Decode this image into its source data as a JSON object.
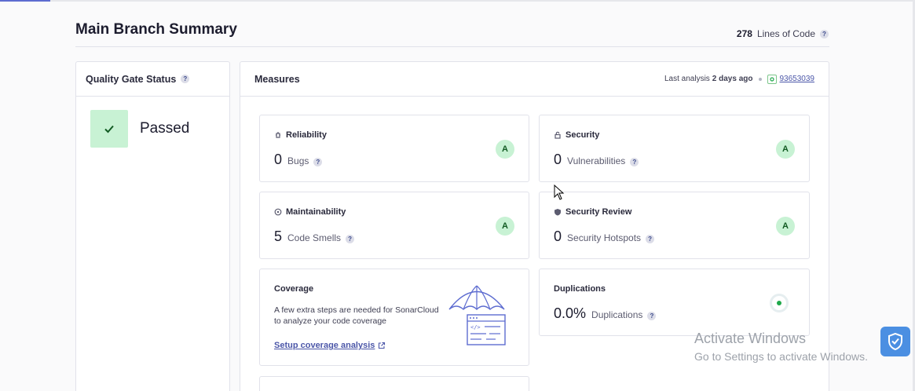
{
  "header": {
    "title": "Main Branch Summary",
    "loc_value": "278",
    "loc_label": "Lines of Code"
  },
  "quality_gate": {
    "title": "Quality Gate Status",
    "status": "Passed"
  },
  "measures": {
    "title": "Measures",
    "last_analysis_label": "Last analysis",
    "last_analysis_value": "2 days ago",
    "commit": "93653039"
  },
  "cards": {
    "reliability": {
      "title": "Reliability",
      "value": "0",
      "label": "Bugs",
      "rating": "A"
    },
    "security": {
      "title": "Security",
      "value": "0",
      "label": "Vulnerabilities",
      "rating": "A"
    },
    "maintainability": {
      "title": "Maintainability",
      "value": "5",
      "label": "Code Smells",
      "rating": "A"
    },
    "security_review": {
      "title": "Security Review",
      "value": "0",
      "label": "Security Hotspots",
      "rating": "A"
    },
    "coverage": {
      "title": "Coverage",
      "text": "A few extra steps are needed for SonarCloud to analyze your code coverage",
      "link": "Setup coverage analysis"
    },
    "duplications": {
      "title": "Duplications",
      "value": "0.0%",
      "label": "Duplications"
    }
  },
  "help_glyph": "?",
  "windows_watermark": {
    "line1": "Activate Windows",
    "line2": "Go to Settings to activate Windows."
  },
  "colors": {
    "accent": "#4b56a8",
    "rating_bg": "#c8f2d4",
    "rating_fg": "#125b23",
    "passed_bg": "#c8f2d4"
  }
}
